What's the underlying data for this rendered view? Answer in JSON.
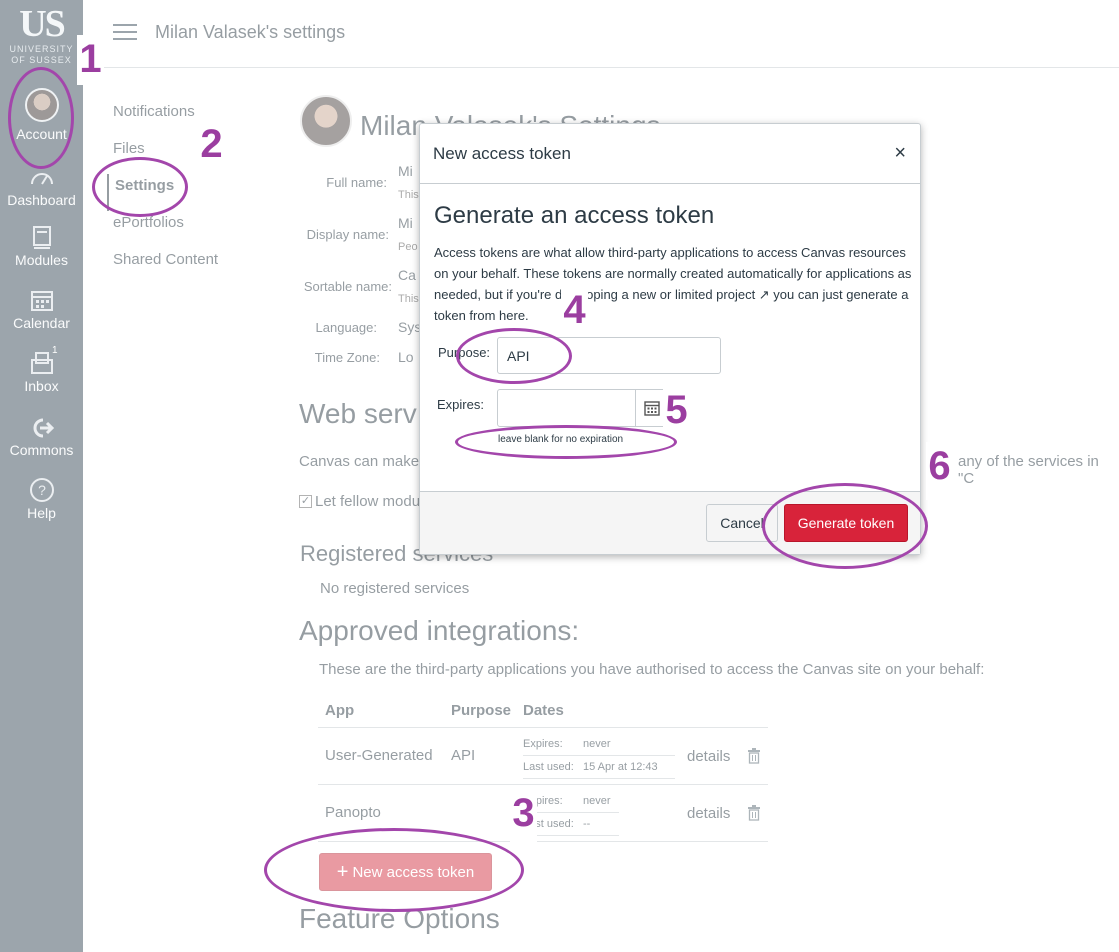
{
  "gnav": {
    "logo_text": "US",
    "logo_sub1": "UNIVERSITY",
    "logo_sub2": "OF SUSSEX",
    "items": [
      {
        "label": "Account"
      },
      {
        "label": "Dashboard"
      },
      {
        "label": "Modules"
      },
      {
        "label": "Calendar"
      },
      {
        "label": "Inbox",
        "badge": "1"
      },
      {
        "label": "Commons"
      },
      {
        "label": "Help"
      }
    ]
  },
  "header": {
    "breadcrumb": "Milan Valasek's settings"
  },
  "subnav": {
    "items": [
      {
        "label": "Notifications"
      },
      {
        "label": "Files"
      },
      {
        "label": "Settings"
      },
      {
        "label": "ePortfolios"
      },
      {
        "label": "Shared Content"
      }
    ]
  },
  "profile": {
    "name": "Milan Valasek's Settings",
    "fields": [
      {
        "label": "Full name:",
        "value": "Mi",
        "sub": "This"
      },
      {
        "label": "Display name:",
        "value": "Mi",
        "sub": "Peo"
      },
      {
        "label": "Sortable name:",
        "value": "Ca",
        "sub": "This"
      },
      {
        "label": "Language:",
        "value": "Sys"
      },
      {
        "label": "Time Zone:",
        "value": "Lo"
      }
    ]
  },
  "web_services": {
    "title": "Web serv",
    "desc_left": "Canvas can make",
    "desc_right": "any of the services in \"C",
    "checkbox_label": "Let fellow modu"
  },
  "registered": {
    "title": "Registered services",
    "empty": "No registered services"
  },
  "integrations": {
    "title": "Approved integrations:",
    "desc": "These are the third-party applications you have authorised to access the Canvas site on your behalf:",
    "columns": [
      "App",
      "Purpose",
      "Dates"
    ],
    "rows": [
      {
        "app": "User-Generated",
        "purpose": "API",
        "expires_k": "Expires:",
        "expires_v": "never",
        "last_k": "Last used:",
        "last_v": "15 Apr at 12:43",
        "details": "details"
      },
      {
        "app": "Panopto",
        "purpose": "",
        "expires_k": "Expires:",
        "expires_v": "never",
        "last_k": "Last used:",
        "last_v": "--",
        "details": "details"
      }
    ],
    "new_token_label": "New access token"
  },
  "feature_options": {
    "title": "Feature Options"
  },
  "modal": {
    "title": "New access token",
    "close": "×",
    "heading": "Generate an access token",
    "desc": "Access tokens are what allow third-party applications to access Canvas resources on your behalf. These tokens are normally created automatically for applications as needed, but if you're developing a new or limited project ↗ you can just generate a token from here.",
    "purpose_label": "Purpose:",
    "purpose_value": "API",
    "expires_label": "Expires:",
    "expires_value": "",
    "hint": "leave blank for no expiration",
    "cancel": "Cancel",
    "generate": "Generate token"
  },
  "annotations": [
    "1",
    "2",
    "3",
    "4",
    "5",
    "6"
  ],
  "colors": {
    "nav_bg": "#394b58",
    "primary": "#d8233a",
    "annotation": "#a346ab"
  }
}
